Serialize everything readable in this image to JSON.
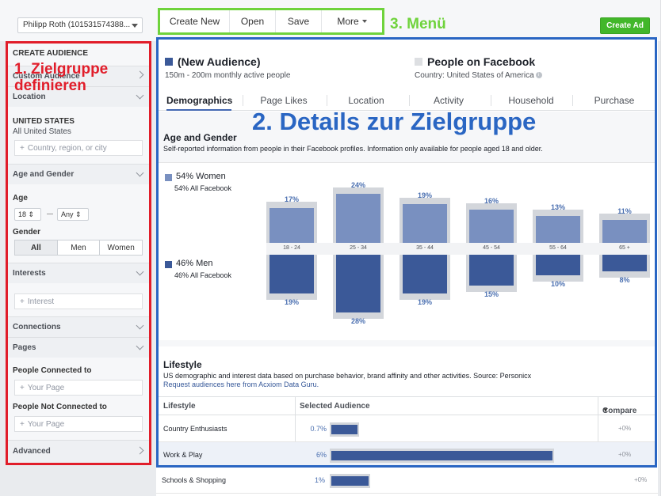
{
  "topbar": {
    "account": "Philipp Roth (101531574388...",
    "menu": [
      "Create New",
      "Open",
      "Save",
      "More"
    ],
    "menu_annotation": "3. Menü",
    "create_ad": "Create Ad"
  },
  "sidebar": {
    "annotation_line1": "1. Zielgruppe",
    "annotation_line2": "definieren",
    "title": "CREATE AUDIENCE",
    "custom_audience": "Custom Audience",
    "location": "Location",
    "country_head": "UNITED STATES",
    "country_sub": "All United States",
    "country_placeholder": "Country, region, or city",
    "age_gender": "Age and Gender",
    "age_label": "Age",
    "age_min": "18",
    "age_max": "Any",
    "gender_label": "Gender",
    "gender_options": [
      "All",
      "Men",
      "Women"
    ],
    "interests": "Interests",
    "interest_placeholder": "Interest",
    "connections": "Connections",
    "pages": "Pages",
    "people_connected": "People Connected to",
    "people_not_connected": "People Not Connected to",
    "page_placeholder": "Your Page",
    "advanced": "Advanced"
  },
  "main": {
    "annotation": "2. Details zur Zielgruppe",
    "audience_title": "(New Audience)",
    "audience_sub": "150m - 200m monthly active people",
    "fb_title": "People on Facebook",
    "fb_sub": "Country: United States of America",
    "tabs": [
      "Demographics",
      "Page Likes",
      "Location",
      "Activity",
      "Household",
      "Purchase"
    ],
    "age_gender_title": "Age and Gender",
    "age_gender_desc": "Self-reported information from people in their Facebook profiles. Information only available for people aged 18 and older.",
    "women_pct": "54% Women",
    "women_all": "54% All Facebook",
    "men_pct": "46% Men",
    "men_all": "46% All Facebook",
    "lifestyle_title": "Lifestyle",
    "lifestyle_desc": "US demographic and interest data based on purchase behavior, brand affinity and other activities. Source: Personicx",
    "lifestyle_link": "Request audiences here from Acxiom Data Guru.",
    "table_headers": [
      "Lifestyle",
      "Selected Audience",
      "Compare"
    ],
    "rows": [
      {
        "name": "Country Enthusiasts",
        "pct": "0.7%",
        "value": 0.7,
        "compare": "+0%"
      },
      {
        "name": "Work & Play",
        "pct": "6%",
        "value": 6,
        "compare": "+0%"
      },
      {
        "name": "Schools & Shopping",
        "pct": "1%",
        "value": 1,
        "compare": "+0%"
      }
    ]
  },
  "colors": {
    "women": "#7990c0",
    "men": "#3b5998",
    "menu_box": "#6fd33c",
    "sidebar_box": "#e11d2a",
    "main_box": "#2a66c3"
  },
  "chart_data": {
    "type": "bar",
    "categories": [
      "18 - 24",
      "25 - 34",
      "35 - 44",
      "45 - 54",
      "55 - 64",
      "65 +"
    ],
    "series": [
      {
        "name": "54% Women",
        "values": [
          17,
          24,
          19,
          16,
          13,
          11
        ],
        "labels": [
          "17%",
          "24%",
          "19%",
          "16%",
          "13%",
          "11%"
        ]
      },
      {
        "name": "46% Men",
        "values": [
          19,
          28,
          19,
          15,
          10,
          8
        ],
        "labels": [
          "19%",
          "28%",
          "19%",
          "15%",
          "10%",
          "8%"
        ]
      }
    ]
  }
}
